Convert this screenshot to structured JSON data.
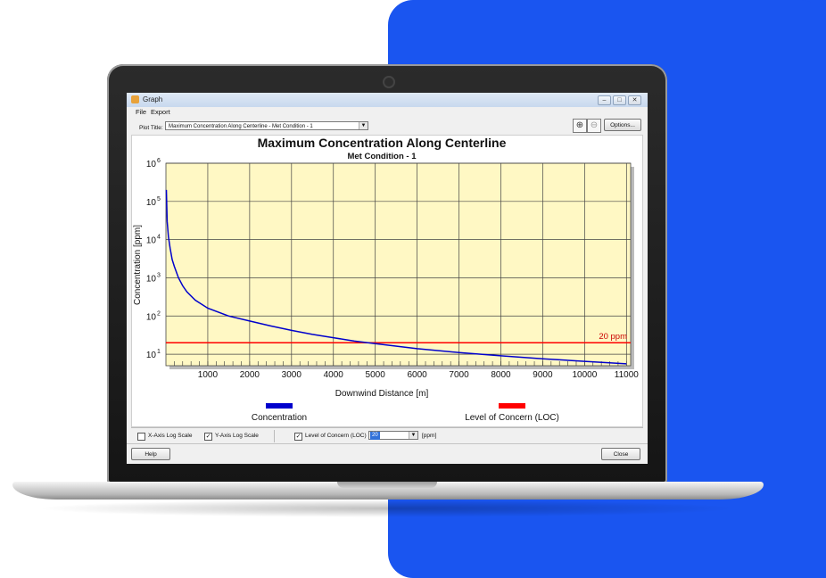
{
  "window": {
    "title": "Graph",
    "menu": [
      "File",
      "Export"
    ]
  },
  "toolbar": {
    "plot_title_label": "Plot Title:",
    "plot_title_value": "Maximum Concentration Along Centerline - Met Condition - 1",
    "zoom_in_icon": "zoom-in-icon",
    "zoom_out_icon": "zoom-out-icon",
    "options_label": "Options..."
  },
  "options": {
    "x_log_label": "X-Axis Log Scale",
    "x_log_checked": false,
    "y_log_label": "Y-Axis Log Scale",
    "y_log_checked": true,
    "loc_label": "Level of Concern (LOC)",
    "loc_checked": true,
    "loc_value": "20",
    "loc_unit": "[ppm]"
  },
  "buttons": {
    "help": "Help",
    "close": "Close"
  },
  "colors": {
    "brand_panel": "#1a55f0",
    "plot_background": "#fff8c4",
    "concentration": "#0000cc",
    "loc": "#ff0000"
  },
  "chart_data": {
    "type": "line",
    "title": "Maximum Concentration Along Centerline",
    "subtitle": "Met Condition - 1",
    "xlabel": "Downwind Distance [m]",
    "ylabel": "Concentration [ppm]",
    "x_ticks": [
      "1000",
      "2000",
      "3000",
      "4000",
      "5000",
      "6000",
      "7000",
      "8000",
      "9000",
      "10000",
      "11000"
    ],
    "y_ticks": [
      {
        "base": "10",
        "exp": "1"
      },
      {
        "base": "10",
        "exp": "2"
      },
      {
        "base": "10",
        "exp": "3"
      },
      {
        "base": "10",
        "exp": "4"
      },
      {
        "base": "10",
        "exp": "5"
      },
      {
        "base": "10",
        "exp": "6"
      }
    ],
    "xlim": [
      0,
      11100
    ],
    "ylim": [
      5,
      1000000
    ],
    "y_scale": "log",
    "grid": true,
    "series": [
      {
        "name": "Concentration",
        "x": [
          10,
          30,
          60,
          100,
          150,
          200,
          300,
          400,
          500,
          700,
          1000,
          1500,
          2000,
          2500,
          3000,
          3500,
          4000,
          4500,
          5000,
          6000,
          7000,
          8000,
          9000,
          10000,
          11000
        ],
        "y": [
          200000,
          30000,
          12000,
          6000,
          3000,
          2000,
          1000,
          620,
          430,
          260,
          160,
          100,
          74,
          55,
          42,
          33,
          27,
          22,
          19,
          14,
          11,
          9.1,
          7.6,
          6.5,
          5.6
        ]
      },
      {
        "name": "Level of Concern (LOC)",
        "x": [
          0,
          11100
        ],
        "y": [
          20,
          20
        ]
      }
    ],
    "annotations": [
      {
        "text": "20 ppm"
      }
    ],
    "legend": [
      "Concentration",
      "Level of Concern (LOC)"
    ],
    "legend_position": "bottom"
  }
}
